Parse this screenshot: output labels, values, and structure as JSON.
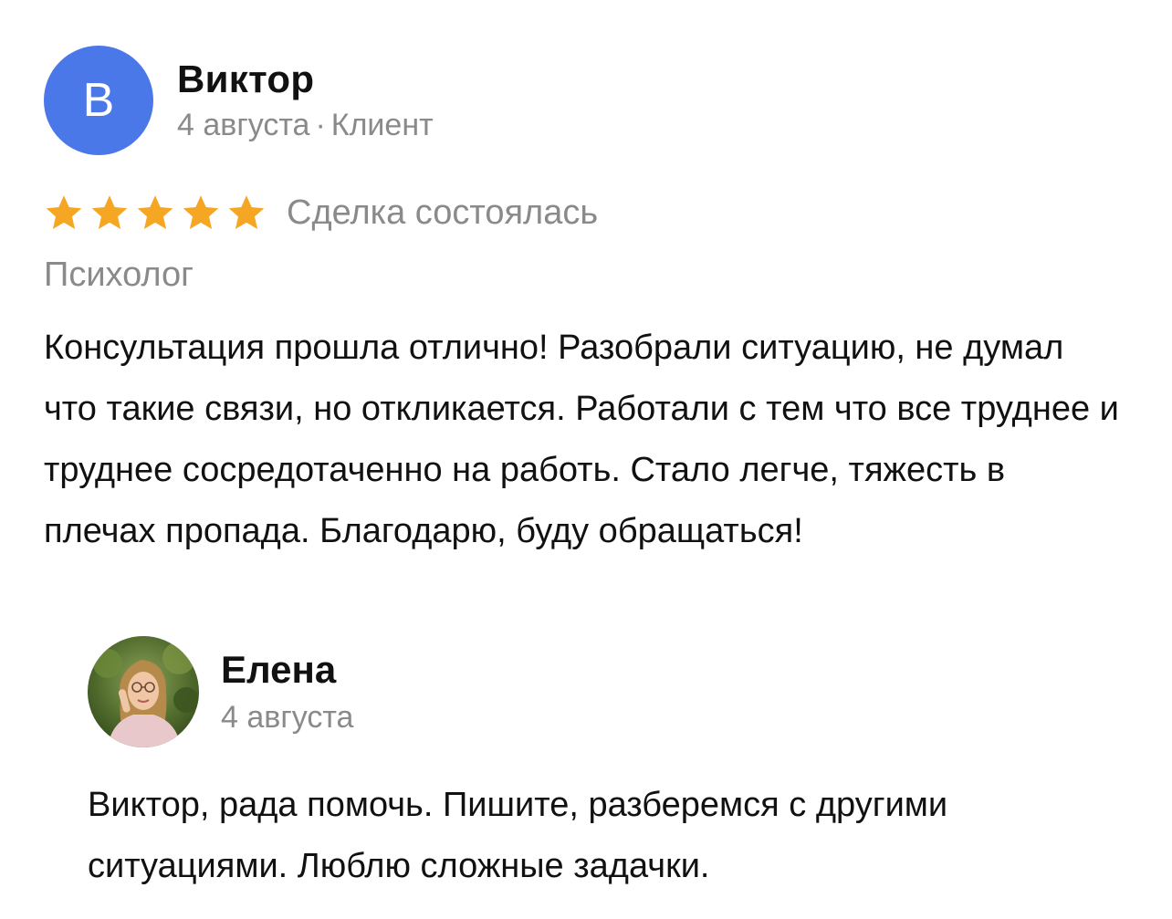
{
  "review": {
    "avatar_letter": "В",
    "author_name": "Виктор",
    "date": "4 августа",
    "separator": "·",
    "role": "Клиент",
    "rating": 5,
    "star_color": "#f5a623",
    "deal_status": "Сделка состоялась",
    "service": "Психолог",
    "text": "Консультация прошла отлично! Разобрали ситуацию, не думал что такие связи, но откликается. Работали с тем что все труднее и труднее сосредотаченно на работь. Стало легче, тяжесть в плечах пропада. Благодарю, буду обращаться!"
  },
  "reply": {
    "author_name": "Елена",
    "date": "4 августа",
    "text": "Виктор, рада помочь. Пишите, разберемся с другими ситуациями. Люблю сложные задачки."
  }
}
